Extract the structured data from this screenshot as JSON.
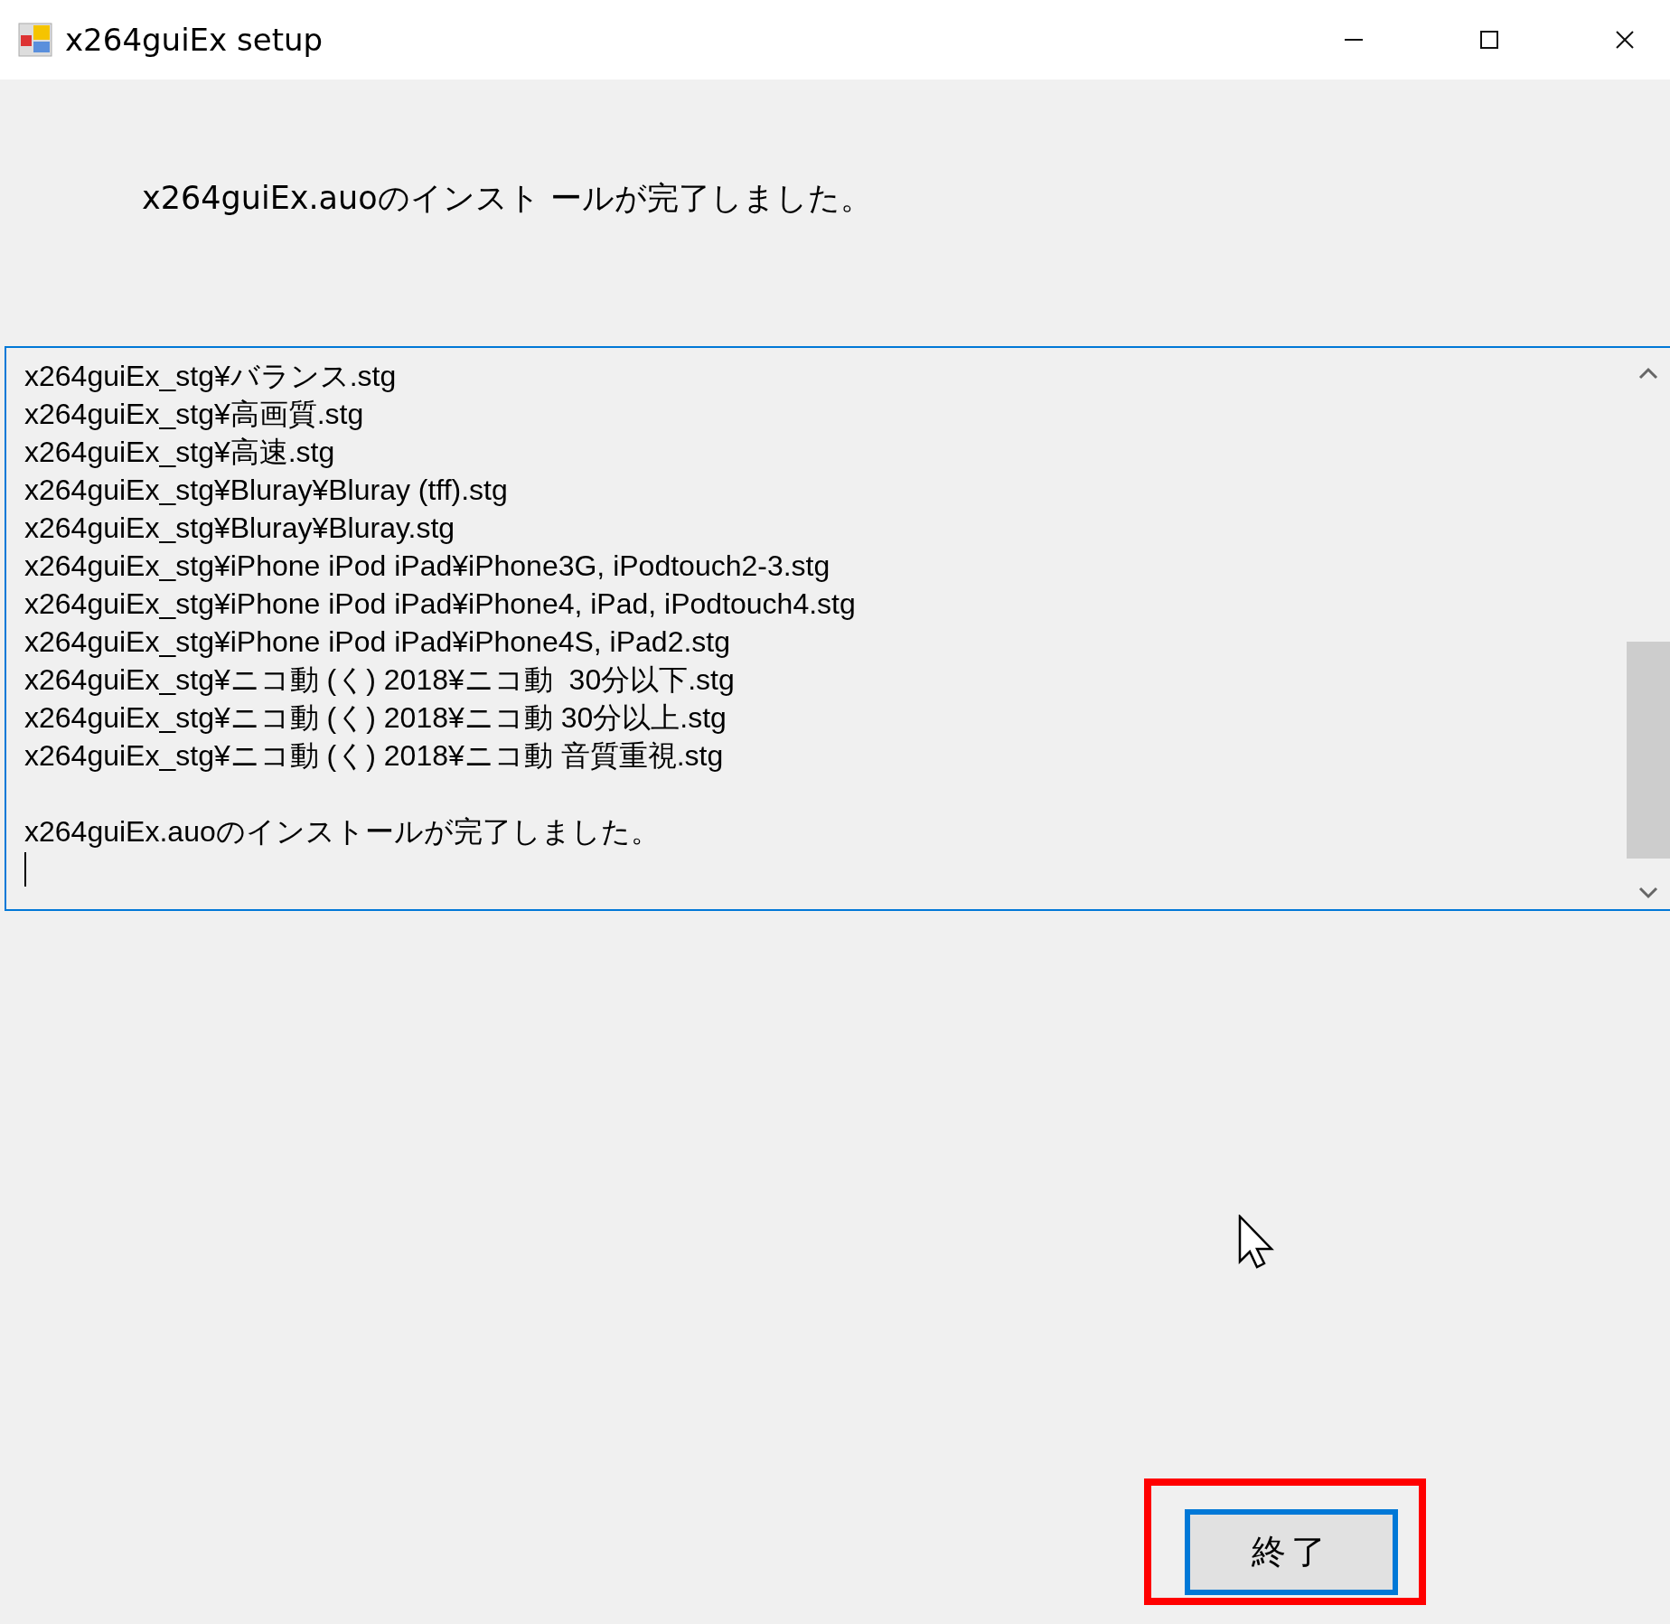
{
  "window": {
    "title": "x264guiEx setup"
  },
  "message": "x264guiEx.auoのインスト ールが完了しました。",
  "log": {
    "lines": [
      "x264guiEx_stg¥バランス.stg",
      "x264guiEx_stg¥高画質.stg",
      "x264guiEx_stg¥高速.stg",
      "x264guiEx_stg¥Bluray¥Bluray (tff).stg",
      "x264guiEx_stg¥Bluray¥Bluray.stg",
      "x264guiEx_stg¥iPhone iPod iPad¥iPhone3G, iPodtouch2-3.stg",
      "x264guiEx_stg¥iPhone iPod iPad¥iPhone4, iPad, iPodtouch4.stg",
      "x264guiEx_stg¥iPhone iPod iPad¥iPhone4S, iPad2.stg",
      "x264guiEx_stg¥ニコ動 (く) 2018¥ニコ動  30分以下.stg",
      "x264guiEx_stg¥ニコ動 (く) 2018¥ニコ動 30分以上.stg",
      "x264guiEx_stg¥ニコ動 (く) 2018¥ニコ動 音質重視.stg"
    ],
    "final_line": "x264guiEx.auoのインストールが完了しました。"
  },
  "finish_button": {
    "label": "終了"
  }
}
